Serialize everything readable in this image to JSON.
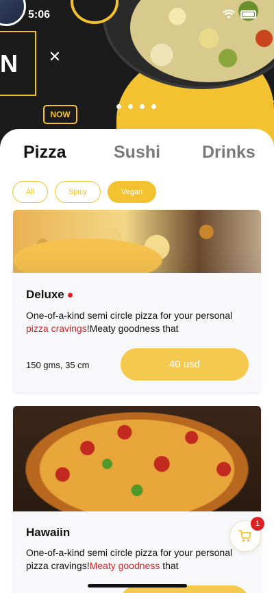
{
  "status_bar": {
    "time": "5:06"
  },
  "banner": {
    "headline_letter": "N",
    "cta_label": "NOW",
    "carousel_dots": 4
  },
  "tabs": [
    {
      "label": "Pizza",
      "active": true
    },
    {
      "label": "Sushi",
      "active": false
    },
    {
      "label": "Drinks",
      "active": false
    }
  ],
  "filters": [
    {
      "label": "All",
      "active": false
    },
    {
      "label": "Spicy",
      "active": false
    },
    {
      "label": "Vegan",
      "active": true
    }
  ],
  "products": [
    {
      "name": "Deluxe",
      "has_indicator": true,
      "desc_before": "One-of-a-kind semi circle pizza for your personal ",
      "desc_highlight": "pizza cravings",
      "desc_after": "!Meaty goodness that",
      "meta": "150 gms, 35 cm",
      "price_label": "40 usd"
    },
    {
      "name": "Hawaiin",
      "has_indicator": false,
      "desc_before": "One-of-a-kind semi circle pizza for your personal pizza cravings!",
      "desc_highlight": "Meaty goodness",
      "desc_after": " that"
    }
  ],
  "cart": {
    "count": "1"
  },
  "colors": {
    "accent": "#f2c230",
    "price_button": "#f5c94e",
    "highlight": "#e02020",
    "dark_banner": "#1b1b1b"
  }
}
